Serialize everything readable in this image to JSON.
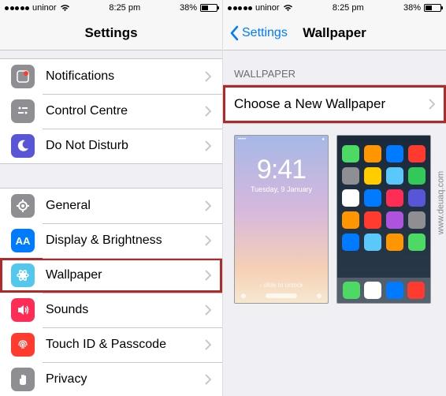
{
  "status": {
    "carrier": "uninor",
    "time": "8:25 pm",
    "battery_pct": "38%"
  },
  "left": {
    "nav_title": "Settings",
    "groups": [
      {
        "rows": [
          {
            "key": "notifications",
            "label": "Notifications",
            "icon": "notifications",
            "icon_bg": "#ff3b30"
          },
          {
            "key": "control-centre",
            "label": "Control Centre",
            "icon": "control-centre",
            "icon_bg": "#8e8e93"
          },
          {
            "key": "dnd",
            "label": "Do Not Disturb",
            "icon": "moon",
            "icon_bg": "#5856d6"
          }
        ]
      },
      {
        "rows": [
          {
            "key": "general",
            "label": "General",
            "icon": "gear",
            "icon_bg": "#8e8e93"
          },
          {
            "key": "display",
            "label": "Display & Brightness",
            "icon": "AA",
            "icon_bg": "#007aff"
          },
          {
            "key": "wallpaper",
            "label": "Wallpaper",
            "icon": "flower",
            "icon_bg": "#54c7ec",
            "highlight": true
          },
          {
            "key": "sounds",
            "label": "Sounds",
            "icon": "speaker",
            "icon_bg": "#ff2d55"
          },
          {
            "key": "touchid",
            "label": "Touch ID & Passcode",
            "icon": "fingerprint",
            "icon_bg": "#ff3b30"
          },
          {
            "key": "privacy",
            "label": "Privacy",
            "icon": "hand",
            "icon_bg": "#8e8e93"
          }
        ]
      }
    ]
  },
  "right": {
    "nav_back": "Settings",
    "nav_title": "Wallpaper",
    "section_header": "WALLPAPER",
    "choose_label": "Choose a New Wallpaper",
    "lock": {
      "time": "9:41",
      "date": "Tuesday, 9 January"
    },
    "home_icons": [
      "#4cd964",
      "#ff9500",
      "#007aff",
      "#ff3b30",
      "#8e8e93",
      "#ffcc00",
      "#5ac8fa",
      "#34c759",
      "#ffffff",
      "#007aff",
      "#ff2d55",
      "#5856d6",
      "#ff9500",
      "#ff3b30",
      "#af52de",
      "#8e8e93",
      "#007aff",
      "#5ac8fa",
      "#ff9500",
      "#4cd964"
    ],
    "dock_icons": [
      "#4cd964",
      "#ffffff",
      "#007aff",
      "#ff3b30"
    ]
  },
  "watermark": "www.deuaq.com"
}
